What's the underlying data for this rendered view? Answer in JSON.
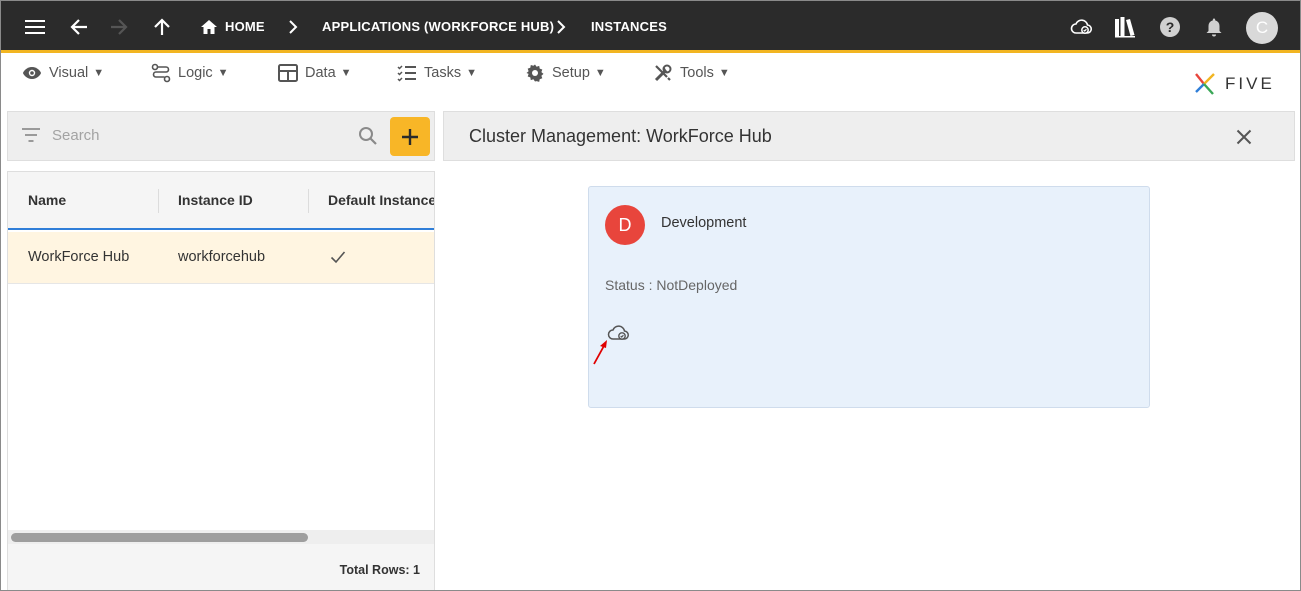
{
  "topbar": {
    "breadcrumbs": {
      "home": "HOME",
      "applications": "APPLICATIONS (WORKFORCE HUB)",
      "instances": "INSTANCES"
    },
    "avatar_initial": "C",
    "accent_color": "#f2b521"
  },
  "menubar": {
    "visual": "Visual",
    "logic": "Logic",
    "data": "Data",
    "tasks": "Tasks",
    "setup": "Setup",
    "tools": "Tools",
    "caret": "▼",
    "logo_text": "FIVE"
  },
  "list": {
    "search_placeholder": "Search",
    "columns": {
      "name": "Name",
      "instance_id": "Instance ID",
      "default_instance": "Default Instance"
    },
    "rows": [
      {
        "name": "WorkForce Hub",
        "instance_id": "workforcehub",
        "default_instance": true
      }
    ],
    "total_rows": "Total Rows: 1"
  },
  "detail": {
    "title": "Cluster Management: WorkForce Hub",
    "card": {
      "avatar_initial": "D",
      "name": "Development",
      "status": "Status : NotDeployed",
      "action_icon": "cloud-deploy-icon"
    }
  }
}
